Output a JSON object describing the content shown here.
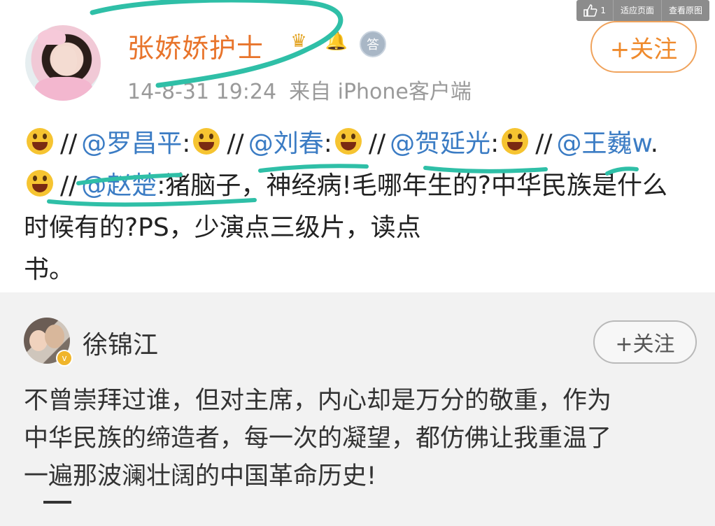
{
  "viewer_toolbar": {
    "like_count": "1",
    "fit_page": "适应页面",
    "view_original": "查看原图"
  },
  "post": {
    "username": "张娇娇护士",
    "badges": [
      "crown-badge-icon",
      "bell-badge-icon",
      "answer-badge-icon"
    ],
    "answer_badge_text": "答",
    "timestamp": "14-8-31 19:24",
    "source": "来自 iPhone客户端",
    "follow_label": "+关注",
    "body": {
      "slashes": "//",
      "mentions": [
        "@罗昌平",
        "@刘春",
        "@贺延光",
        "@王巍w",
        "@赵楚"
      ],
      "colon": ":",
      "dot": ".",
      "text_line1": "猪脑子，神经病!毛哪年生的?中",
      "text_line2": "华民族是什么时候有的?PS，少演点三级片，读点",
      "text_line3": "书。"
    }
  },
  "comment": {
    "username": "徐锦江",
    "verified": "v",
    "follow_label": "+关注",
    "text_line1": "不曾崇拜过谁，但对主席，内心却是万分的敬重，作为",
    "text_line2": "中华民族的缔造者，每一次的凝望，都仿佛让我重温了",
    "text_line3": "一遍那波澜壮阔的中国革命历史!"
  },
  "colors": {
    "username_orange": "#e8742b",
    "mention_blue": "#3b7cc4",
    "scribble_teal": "#2fbfa7",
    "comment_bg": "#f2f2f2"
  }
}
